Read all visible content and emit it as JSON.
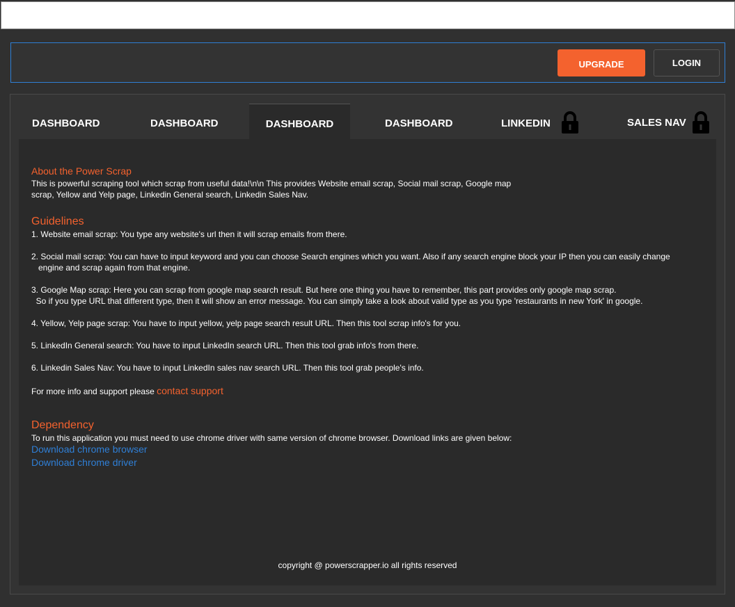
{
  "header": {
    "upgrade_label": "UPGRADE",
    "login_label": "LOGIN"
  },
  "tabs": [
    {
      "label": "DASHBOARD",
      "locked": false,
      "active": false
    },
    {
      "label": "DASHBOARD",
      "locked": false,
      "active": false
    },
    {
      "label": "DASHBOARD",
      "locked": false,
      "active": true
    },
    {
      "label": "DASHBOARD",
      "locked": false,
      "active": false
    },
    {
      "label": "LINKEDIN",
      "locked": true,
      "active": false,
      "icon": "lock-icon"
    },
    {
      "label": "SALES NAV",
      "locked": true,
      "active": false,
      "icon": "lock-icon"
    }
  ],
  "about": {
    "title": "About the Power Scrap",
    "line1": "This is powerful scraping tool which scrap from useful data!\\n\\n This provides Website email scrap, Social mail scrap, Google map",
    "line2": "scrap, Yellow and Yelp page, Linkedin General search, Linkedin Sales Nav."
  },
  "guidelines": {
    "title": "Guidelines",
    "items": [
      [
        "1. Website email scrap: You type any website's url then it will scrap emails from there."
      ],
      [
        "2. Social mail scrap: You can have to input keyword and you can choose Search engines which you want. Also if any search engine block your IP then you can easily change",
        "   engine and scrap again from that engine."
      ],
      [
        "3. Google Map scrap: Here you can scrap from google map search result. But here one thing you have to remember, this part provides only google map scrap.",
        "  So if you type URL that different type, then it will show an error message. You can simply take a look about valid type as you type 'restaurants in new York' in google."
      ],
      [
        "4. Yellow, Yelp page scrap: You have to input yellow, yelp page search result URL. Then this tool scrap info's for you."
      ],
      [
        "5. LinkedIn General search: You have to input LinkedIn search URL. Then this tool grab info's from there."
      ],
      [
        "6. Linkedin Sales Nav: You have to input LinkedIn sales nav search URL. Then this tool grab people's info."
      ]
    ],
    "support_prefix": "For more info and support please ",
    "support_link": "contact support"
  },
  "dependency": {
    "title": "Dependency",
    "text": "To run this application you must need to use chrome driver with same version of chrome browser. Download links are given below:",
    "link_browser": "Download chrome browser",
    "link_driver": "Download chrome driver"
  },
  "footer": {
    "copyright": "copyright @ powerscrapper.io all rights reserved"
  },
  "colors": {
    "accent": "#f4622e",
    "link": "#2f7fd6",
    "background": "#303030",
    "content_bg": "#2a2a2a"
  }
}
